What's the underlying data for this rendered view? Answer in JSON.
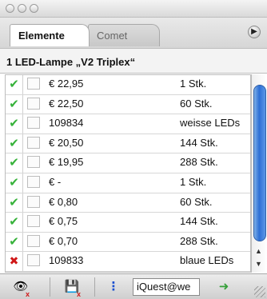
{
  "window": {
    "controls": [
      "close-button",
      "minimize-button",
      "zoom-button"
    ]
  },
  "tabs": [
    {
      "label": "Elemente",
      "active": true
    },
    {
      "label": "Comet",
      "active": false
    }
  ],
  "product_title": "1 LED-Lampe „V2 Triplex“",
  "rows": [
    {
      "status": "ok",
      "price": "€ 22,95",
      "qty": "1 Stk."
    },
    {
      "status": "ok",
      "price": "€ 22,50",
      "qty": "60 Stk."
    },
    {
      "status": "ok",
      "price": "109834",
      "qty": "weisse LEDs"
    },
    {
      "status": "ok",
      "price": "€ 20,50",
      "qty": "144 Stk."
    },
    {
      "status": "ok",
      "price": "€ 19,95",
      "qty": "288 Stk."
    },
    {
      "status": "ok",
      "price": "€ -",
      "qty": "1 Stk."
    },
    {
      "status": "ok",
      "price": "€ 0,80",
      "qty": "60 Stk."
    },
    {
      "status": "ok",
      "price": "€ 0,75",
      "qty": "144 Stk."
    },
    {
      "status": "ok",
      "price": "€ 0,70",
      "qty": "288 Stk."
    },
    {
      "status": "error",
      "price": "109833",
      "qty": "blaue LEDs"
    }
  ],
  "glyphs": {
    "check": "✔",
    "cross": "✖",
    "panel_menu": "▶",
    "arrow_up": "▲",
    "arrow_down": "▼",
    "eye": "👁",
    "save": "💾",
    "more": "⋮",
    "apply": "➜",
    "x": "x"
  },
  "bottom": {
    "search_value": "iQuest@we"
  },
  "colors": {
    "ok": "#36b23a",
    "error": "#d01818",
    "scroll_thumb": "#2d6fd6",
    "tab_active_bg": "#ffffff"
  }
}
